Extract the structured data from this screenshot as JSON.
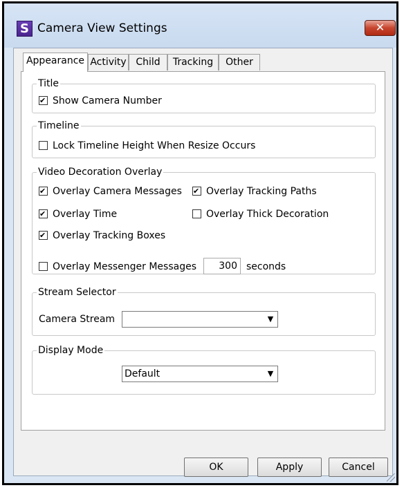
{
  "window": {
    "app_icon_letter": "S",
    "title": "Camera View Settings",
    "close_glyph": "✕"
  },
  "tabs": [
    {
      "label": "Appearance",
      "active": true
    },
    {
      "label": "Activity",
      "active": false
    },
    {
      "label": "Child",
      "active": false
    },
    {
      "label": "Tracking",
      "active": false
    },
    {
      "label": "Other",
      "active": false
    }
  ],
  "groups": {
    "title": {
      "label": "Title",
      "show_camera_number": {
        "label": "Show Camera Number",
        "checked": true
      }
    },
    "timeline": {
      "label": "Timeline",
      "lock_timeline": {
        "label": "Lock Timeline Height When Resize Occurs",
        "checked": false
      }
    },
    "video_overlay": {
      "label": "Video Decoration Overlay",
      "overlay_camera_messages": {
        "label": "Overlay Camera Messages",
        "checked": true
      },
      "overlay_tracking_paths": {
        "label": "Overlay Tracking Paths",
        "checked": true
      },
      "overlay_time": {
        "label": "Overlay Time",
        "checked": true
      },
      "overlay_thick_decoration": {
        "label": "Overlay Thick Decoration",
        "checked": false
      },
      "overlay_tracking_boxes": {
        "label": "Overlay Tracking Boxes",
        "checked": true
      },
      "overlay_messenger_messages": {
        "label": "Overlay Messenger Messages",
        "checked": false
      },
      "messenger_seconds_value": "300",
      "seconds_label": "seconds"
    },
    "stream_selector": {
      "label": "Stream Selector",
      "camera_stream_label": "Camera Stream",
      "camera_stream_value": ""
    },
    "display_mode": {
      "label": "Display Mode",
      "value": "Default"
    }
  },
  "buttons": {
    "ok": "OK",
    "apply": "Apply",
    "cancel": "Cancel"
  },
  "colors": {
    "window_frame": "#dbe6f4",
    "close_button": "#c7442d",
    "app_icon": "#5a2fa6"
  }
}
